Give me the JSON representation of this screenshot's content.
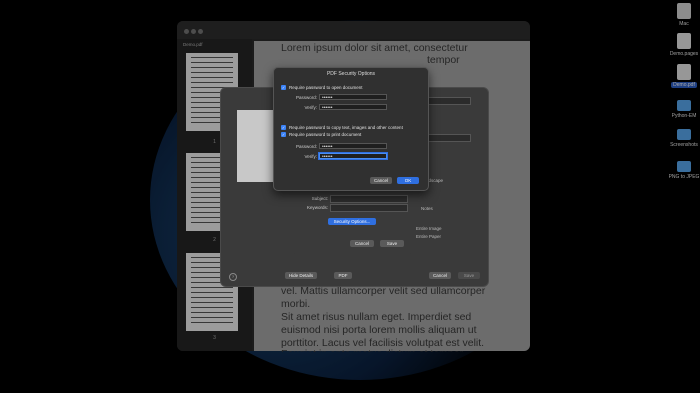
{
  "desktop": {
    "icons": [
      {
        "label": "Mac",
        "kind": "mac"
      },
      {
        "label": "Demo.pages",
        "kind": "file"
      },
      {
        "label": "Demo.pdf",
        "kind": "pdf",
        "selected": true
      },
      {
        "label": "Python-EM",
        "kind": "folder"
      },
      {
        "label": "Screenshots",
        "kind": "folder"
      },
      {
        "label": "PNG to JPEG",
        "kind": "folder"
      }
    ]
  },
  "preview": {
    "sidebar_label": "Demo.pdf",
    "page_numbers": [
      "1",
      "2",
      "3"
    ],
    "page_text": [
      "Lorem ipsum dolor sit amet, consectetur",
      "tempor",
      "vel. Mattis ullamcorper velit sed ullamcorper",
      "morbi.",
      "Sit amet risus nullam eget. Imperdiet sed",
      "euismod nisi porta lorem mollis aliquam ut",
      "porttitor. Lacus vel facilisis volutpat est velit.",
      "Feugiat in ante metus dictum at tempor"
    ]
  },
  "export_sheet": {
    "hide_details": "Hide Details",
    "pdf": "PDF",
    "cancel": "Cancel",
    "save": "Save",
    "subject_label": "Subject:",
    "keywords_label": "Keywords:",
    "security_options": "Security Options...",
    "side_notes": [
      "Landscape",
      "Notes",
      "Entire Image",
      "Entire Paper"
    ]
  },
  "security_dialog": {
    "title": "PDF Security Options",
    "open_checkbox": "Require password to open document",
    "copy_checkbox": "Require password to copy text, images and other content",
    "print_checkbox": "Require password to print document",
    "password_label": "Password:",
    "verify_label": "Verify:",
    "mask": "••••••",
    "cancel": "Cancel",
    "ok": "OK",
    "accent": "#2f6fe0"
  }
}
